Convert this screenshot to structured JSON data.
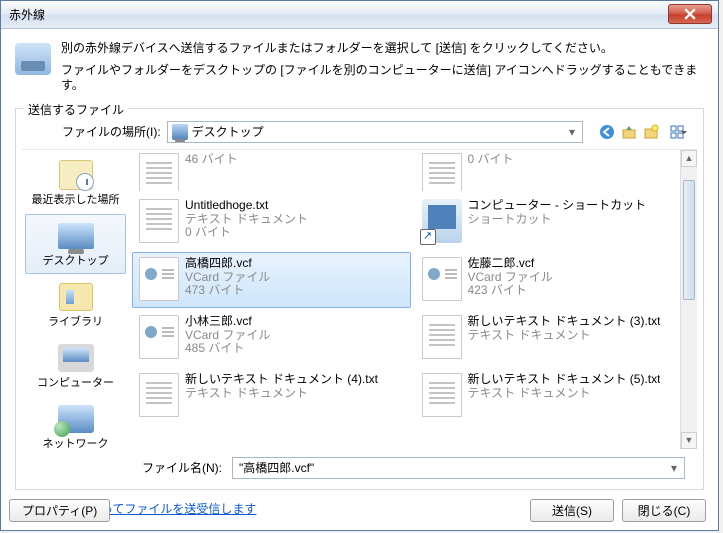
{
  "title": "赤外線",
  "icons": {
    "close": "close-icon",
    "back": "back-icon",
    "up": "up-level-icon",
    "new_folder": "new-folder-icon",
    "view_menu": "view-menu-icon"
  },
  "header": {
    "line1": "別の赤外線デバイスへ送信するファイルまたはフォルダーを選択して [送信] をクリックしてください。",
    "line2": "ファイルやフォルダーをデスクトップの [ファイルを別のコンピューターに送信] アイコンへドラッグすることもできます。"
  },
  "group_label": "送信するファイル",
  "location": {
    "label": "ファイルの場所(I):",
    "value": "デスクトップ"
  },
  "places": [
    {
      "id": "recent",
      "label": "最近表示した場所"
    },
    {
      "id": "desktop",
      "label": "デスクトップ",
      "active": true
    },
    {
      "id": "library",
      "label": "ライブラリ"
    },
    {
      "id": "computer",
      "label": "コンピューター"
    },
    {
      "id": "network",
      "label": "ネットワーク"
    }
  ],
  "files": {
    "col1": [
      {
        "name": "",
        "type": "",
        "size": "46 バイト",
        "icon": "txt",
        "truncated_top": true
      },
      {
        "name": "Untitledhoge.txt",
        "type": "テキスト ドキュメント",
        "size": "0 バイト",
        "icon": "txt"
      },
      {
        "name": "高橋四郎.vcf",
        "type": "VCard ファイル",
        "size": "473 バイト",
        "icon": "vcf",
        "selected": true
      },
      {
        "name": "小林三郎.vcf",
        "type": "VCard ファイル",
        "size": "485 バイト",
        "icon": "vcf"
      },
      {
        "name": "新しいテキスト ドキュメント (4).txt",
        "type": "テキスト ドキュメント",
        "size": "",
        "icon": "txt"
      }
    ],
    "col2": [
      {
        "name": "",
        "type": "",
        "size": "0 バイト",
        "icon": "txt",
        "truncated_top": true
      },
      {
        "name": "コンピューター - ショートカット",
        "type": "ショートカット",
        "size": "",
        "icon": "computer"
      },
      {
        "name": "佐藤二郎.vcf",
        "type": "VCard ファイル",
        "size": "423 バイト",
        "icon": "vcf"
      },
      {
        "name": "新しいテキスト ドキュメント (3).txt",
        "type": "テキスト ドキュメント",
        "size": "",
        "icon": "txt"
      },
      {
        "name": "新しいテキスト ドキュメント (5).txt",
        "type": "テキスト ドキュメント",
        "size": "",
        "icon": "txt"
      }
    ]
  },
  "filename": {
    "label": "ファイル名(N):",
    "value": "\"高橋四郎.vcf\""
  },
  "link_text": "赤外線接続を使ってファイルを送受信します",
  "buttons": {
    "properties": "プロパティ(P)",
    "send": "送信(S)",
    "close": "閉じる(C)"
  }
}
